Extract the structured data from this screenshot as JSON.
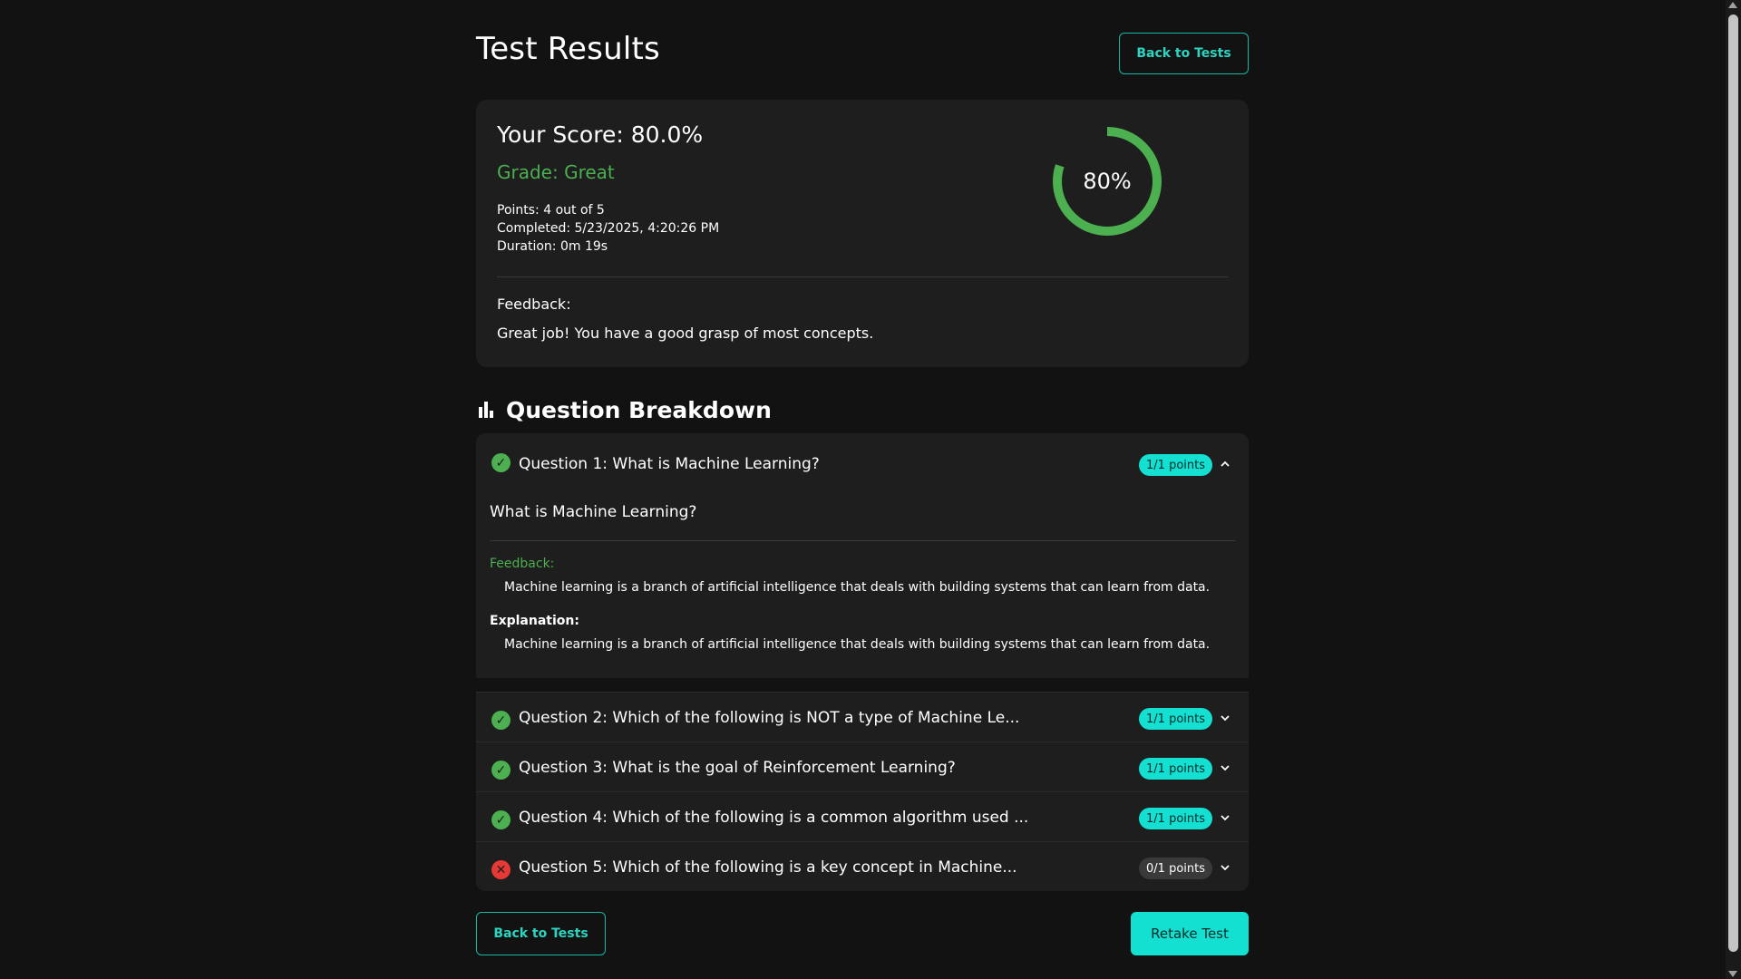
{
  "header": {
    "title": "Test Results",
    "back_label": "Back to Tests"
  },
  "score_card": {
    "score_label": "Your Score: 80.0%",
    "grade_label": "Grade: Great",
    "points": "Points: 4 out of 5",
    "completed": "Completed: 5/23/2025, 4:20:26 PM",
    "duration": "Duration: 0m 19s",
    "gauge_value_text": "80%",
    "gauge_fraction": 0.8,
    "feedback_label": "Feedback:",
    "feedback_text": "Great job! You have a good grasp of most concepts."
  },
  "breakdown": {
    "title": "Question Breakdown",
    "icon": "bar-chart-icon",
    "questions": [
      {
        "title": "Question 1: What is Machine Learning?",
        "points": "1/1 points",
        "status": "correct",
        "expanded": true,
        "question_text": "What is Machine Learning?",
        "feedback_label": "Feedback:",
        "feedback_text": "Machine learning is a branch of artificial intelligence that deals with building systems that can learn from data.",
        "explanation_label": "Explanation:",
        "explanation_text": "Machine learning is a branch of artificial intelligence that deals with building systems that can learn from data."
      },
      {
        "title": "Question 2: Which of the following is NOT a type of Machine Le...",
        "points": "1/1 points",
        "status": "correct",
        "expanded": false
      },
      {
        "title": "Question 3: What is the goal of Reinforcement Learning?",
        "points": "1/1 points",
        "status": "correct",
        "expanded": false
      },
      {
        "title": "Question 4: Which of the following is a common algorithm used ...",
        "points": "1/1 points",
        "status": "correct",
        "expanded": false
      },
      {
        "title": "Question 5: Which of the following is a key concept in Machine...",
        "points": "0/1 points",
        "status": "incorrect",
        "expanded": false
      }
    ]
  },
  "footer": {
    "back_label": "Back to Tests",
    "retake_label": "Retake Test"
  },
  "colors": {
    "background": "#121212",
    "card": "#1e1e1e",
    "accent": "#14e0d2",
    "success": "#4caf50",
    "error": "#e53935"
  }
}
